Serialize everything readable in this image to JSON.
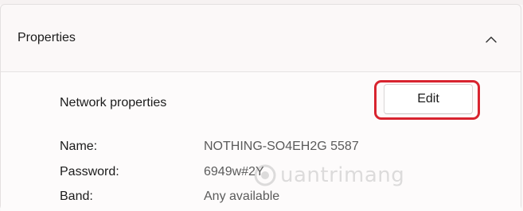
{
  "header": {
    "title": "Properties",
    "toggle_icon": "chevron-up-icon"
  },
  "section": {
    "label": "Network properties",
    "edit_label": "Edit",
    "highlight_color": "#d8242f"
  },
  "properties": [
    {
      "key": "Name:",
      "value": "NOTHING-SO4EH2G 5587"
    },
    {
      "key": "Password:",
      "value": "6949w#2Y"
    },
    {
      "key": "Band:",
      "value": "Any available"
    }
  ],
  "watermark": {
    "text": "uantrimang",
    "icon": "watermark-logo-icon"
  }
}
